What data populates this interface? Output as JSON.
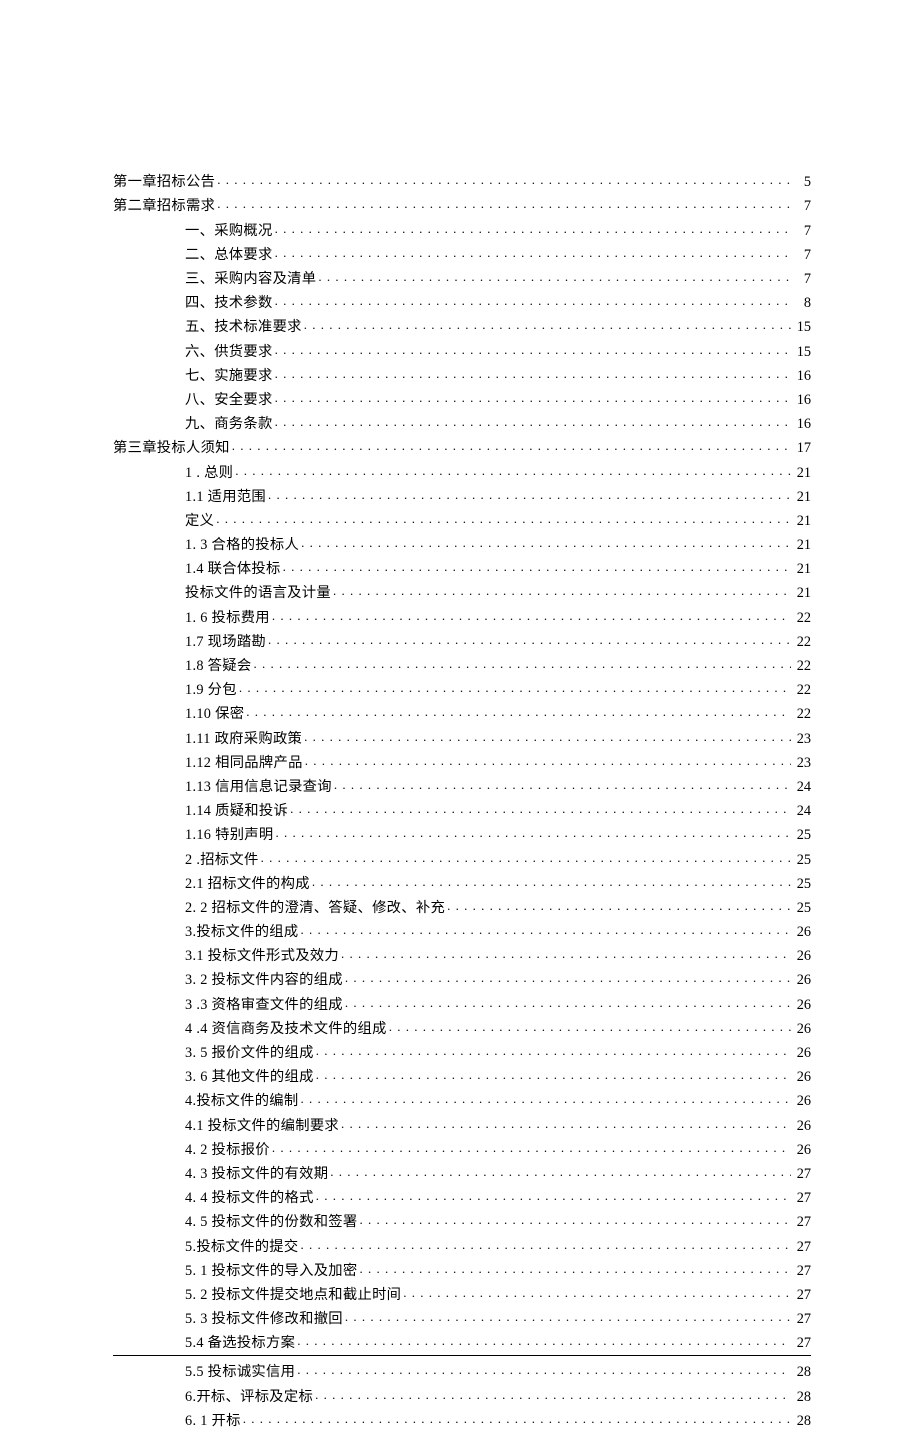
{
  "toc": [
    {
      "indent": 0,
      "label": "第一章招标公告",
      "page": "5"
    },
    {
      "indent": 0,
      "label": "第二章招标需求",
      "page": "7"
    },
    {
      "indent": 1,
      "label": "一、采购概况",
      "page": "7"
    },
    {
      "indent": 1,
      "label": "二、总体要求",
      "page": "7"
    },
    {
      "indent": 1,
      "label": "三、采购内容及清单",
      "page": "7"
    },
    {
      "indent": 1,
      "label": "四、技术参数",
      "page": "8"
    },
    {
      "indent": 1,
      "label": "五、技术标准要求",
      "page": "15"
    },
    {
      "indent": 1,
      "label": "六、供货要求",
      "page": "15"
    },
    {
      "indent": 1,
      "label": "七、实施要求",
      "page": "16"
    },
    {
      "indent": 1,
      "label": "八、安全要求",
      "page": "16"
    },
    {
      "indent": 1,
      "label": "九、商务条款",
      "page": "16"
    },
    {
      "indent": 0,
      "label": "第三章投标人须知",
      "page": "17"
    },
    {
      "indent": 1,
      "label": "1 . 总则",
      "page": "21"
    },
    {
      "indent": 1,
      "label": "1.1   适用范围",
      "page": "21"
    },
    {
      "indent": 1,
      "label": "定义",
      "page": "21"
    },
    {
      "indent": 1,
      "label": "1. 3 合格的投标人",
      "page": "21"
    },
    {
      "indent": 1,
      "label": "1.4   联合体投标",
      "page": "21"
    },
    {
      "indent": 1,
      "label": "投标文件的语言及计量",
      "page": "21"
    },
    {
      "indent": 1,
      "label": "1. 6 投标费用",
      "page": "22"
    },
    {
      "indent": 1,
      "label": "1.7   现场踏勘",
      "page": "22"
    },
    {
      "indent": 1,
      "label": "1.8   答疑会",
      "page": "22"
    },
    {
      "indent": 1,
      "label": "1.9   分包",
      "page": "22"
    },
    {
      "indent": 1,
      "label": "1.10   保密",
      "page": "22"
    },
    {
      "indent": 1,
      "label": "1.11   政府采购政策",
      "page": "23"
    },
    {
      "indent": 1,
      "label": "1.12    相同品牌产品",
      "page": "23"
    },
    {
      "indent": 1,
      "label": "1.13   信用信息记录查询",
      "page": "24"
    },
    {
      "indent": 1,
      "label": "1.14   质疑和投诉",
      "page": "24"
    },
    {
      "indent": 1,
      "label": "1.16   特别声明",
      "page": "25"
    },
    {
      "indent": 1,
      "label": "2   .招标文件",
      "page": "25"
    },
    {
      "indent": 1,
      "label": "2.1   招标文件的构成",
      "page": "25"
    },
    {
      "indent": 1,
      "label": "2.   2 招标文件的澄清、答疑、修改、补充",
      "page": "25"
    },
    {
      "indent": 1,
      "label": "3.投标文件的组成",
      "page": "26"
    },
    {
      "indent": 1,
      "label": "3.1   投标文件形式及效力",
      "page": "26"
    },
    {
      "indent": 1,
      "label": "3.   2 投标文件内容的组成",
      "page": "26"
    },
    {
      "indent": 1,
      "label": "3    .3 资格审查文件的组成",
      "page": "26"
    },
    {
      "indent": 1,
      "label": "4    .4 资信商务及技术文件的组成",
      "page": "26"
    },
    {
      "indent": 1,
      "label": "3.   5 报价文件的组成",
      "page": "26"
    },
    {
      "indent": 1,
      "label": "3.   6 其他文件的组成",
      "page": "26"
    },
    {
      "indent": 1,
      "label": "4.投标文件的编制",
      "page": "26"
    },
    {
      "indent": 1,
      "label": "4.1   投标文件的编制要求",
      "page": "26"
    },
    {
      "indent": 1,
      "label": "4.   2 投标报价",
      "page": "26"
    },
    {
      "indent": 1,
      "label": "4.   3 投标文件的有效期",
      "page": "27"
    },
    {
      "indent": 1,
      "label": "4.   4 投标文件的格式",
      "page": "27"
    },
    {
      "indent": 1,
      "label": "4.   5 投标文件的份数和签署",
      "page": "27"
    },
    {
      "indent": 1,
      "label": "5.投标文件的提交",
      "page": "27"
    },
    {
      "indent": 1,
      "label": "5.   1 投标文件的导入及加密",
      "page": "27"
    },
    {
      "indent": 1,
      "label": "5.   2 投标文件提交地点和截止时间",
      "page": "27"
    },
    {
      "indent": 1,
      "label": "5.   3 投标文件修改和撤回",
      "page": "27"
    },
    {
      "indent": 1,
      "label": "5.4   备选投标方案",
      "page": "27",
      "underline": true
    },
    {
      "indent": 1,
      "label": "5.5   投标诚实信用",
      "page": "28"
    },
    {
      "indent": 1,
      "label": "6.开标、评标及定标",
      "page": "28"
    },
    {
      "indent": 1,
      "label": "6.   1 开标",
      "page": "28"
    }
  ]
}
